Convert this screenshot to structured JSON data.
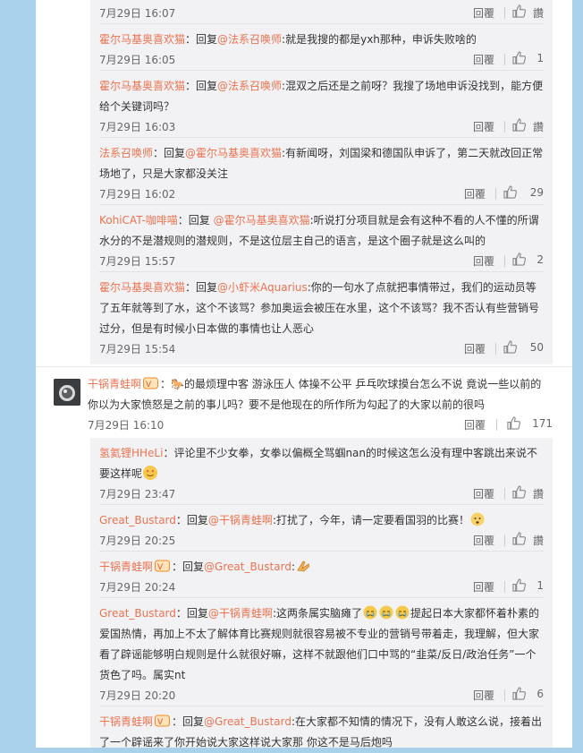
{
  "labels": {
    "reply": "回覆",
    "like_zero": "讚"
  },
  "top_thread": [
    {
      "time": "7月29日 16:07",
      "likes": "讚",
      "text_parts": []
    },
    {
      "name": "霍尔马基奥喜欢猫",
      "mid": "：回复",
      "at": "@法系召唤师",
      "text": ":就是我搜的都是yxh那种，申诉失败啥的",
      "time": "7月29日 16:05",
      "likes": "1"
    },
    {
      "name": "霍尔马基奥喜欢猫",
      "mid": "：回复",
      "at": "@法系召唤师",
      "text": ":混双之后还是之前呀？我搜了场地申诉没找到，能方便给个关键词吗？",
      "time": "7月29日 16:03",
      "likes": "讚"
    },
    {
      "name": "法系召唤师",
      "mid": "：回复",
      "at": "@霍尔马基奥喜欢猫",
      "text": ":有新闻呀，刘国梁和德国队申诉了，第二天就改回正常场地了，只是大家都没关注",
      "time": "7月29日 16:02",
      "likes": "29"
    },
    {
      "name": "KohiCAT-咖啡喵",
      "mid": "：回复 ",
      "at": "@霍尔马基奥喜欢猫",
      "text": ":听说打分项目就是会有这种不看的人不懂的所谓水分的不是潜规则的潜规则，不是这位层主自己的语言，是这个圈子就是这么叫的",
      "time": "7月29日 15:57",
      "likes": "2"
    },
    {
      "name": "霍尔马基奥喜欢猫",
      "mid": "：回复",
      "at": "@小虾米Aquarius",
      "text": ":你的一句水了点就把事情带过，我们的运动员等了五年就等到了水，这个不该骂？参加奥运会被压在水里，这个不该骂？我不否认有些营销号过分，但是有时候小日本做的事情也让人恶心",
      "time": "7月29日 15:54",
      "likes": "50"
    }
  ],
  "main_comment": {
    "name": "干锅青蛙啊",
    "text": "：🐎的最烦理中客 游泳压人 体操不公平 乒乓吹球摸台怎么不说 竟说一些以前的 你以为大家愤怒是之前的事儿吗？要不是他现在的所作所为勾起了的大家以前的很吗",
    "time": "7月29日 16:10",
    "likes": "171"
  },
  "sub_thread": [
    {
      "name": "氢氦锂HHeLi",
      "mid": "",
      "at": "",
      "text": "：评论里不少女拳，女拳以偏概全骂蝈nan的时候这怎么没有理中客跳出来说不要这样呢",
      "time": "7月29日 23:47",
      "likes": "讚"
    },
    {
      "name": "Great_Bustard",
      "mid": "：回复",
      "at": "@干锅青蛙啊",
      "text": ":打扰了，今年，请一定要看国羽的比赛！",
      "time": "7月29日 20:25",
      "likes": "讚"
    },
    {
      "name": "干锅青蛙啊",
      "mid": "：回复",
      "at": "@Great_Bustard",
      "text": ":",
      "time": "7月29日 20:24",
      "likes": "1"
    },
    {
      "name": "Great_Bustard",
      "mid": "：回复",
      "at": "@干锅青蛙啊",
      "text": ":这两条属实脑瘫了",
      "text2": "提起日本大家都怀着朴素的爱国热情，再加上不太了解体育比赛规则就很容易被不专业的营销号带着走，我理解，但大家看了辟谣能够明白规则是什么就很好嘛，这样不就跟他们口中骂的“韭菜/反日/政治任务”一个货色了吗。属实nt",
      "time": "7月29日 20:20",
      "likes": "6"
    },
    {
      "name": "干锅青蛙啊",
      "mid": "：回复",
      "at": "@Great_Bustard",
      "text": ":在大家都不知情的情况下，没有人敢这么说，接着出了一个辟谣来了你开始说大家这样说大家那 你这不是马后炮吗"
    }
  ]
}
